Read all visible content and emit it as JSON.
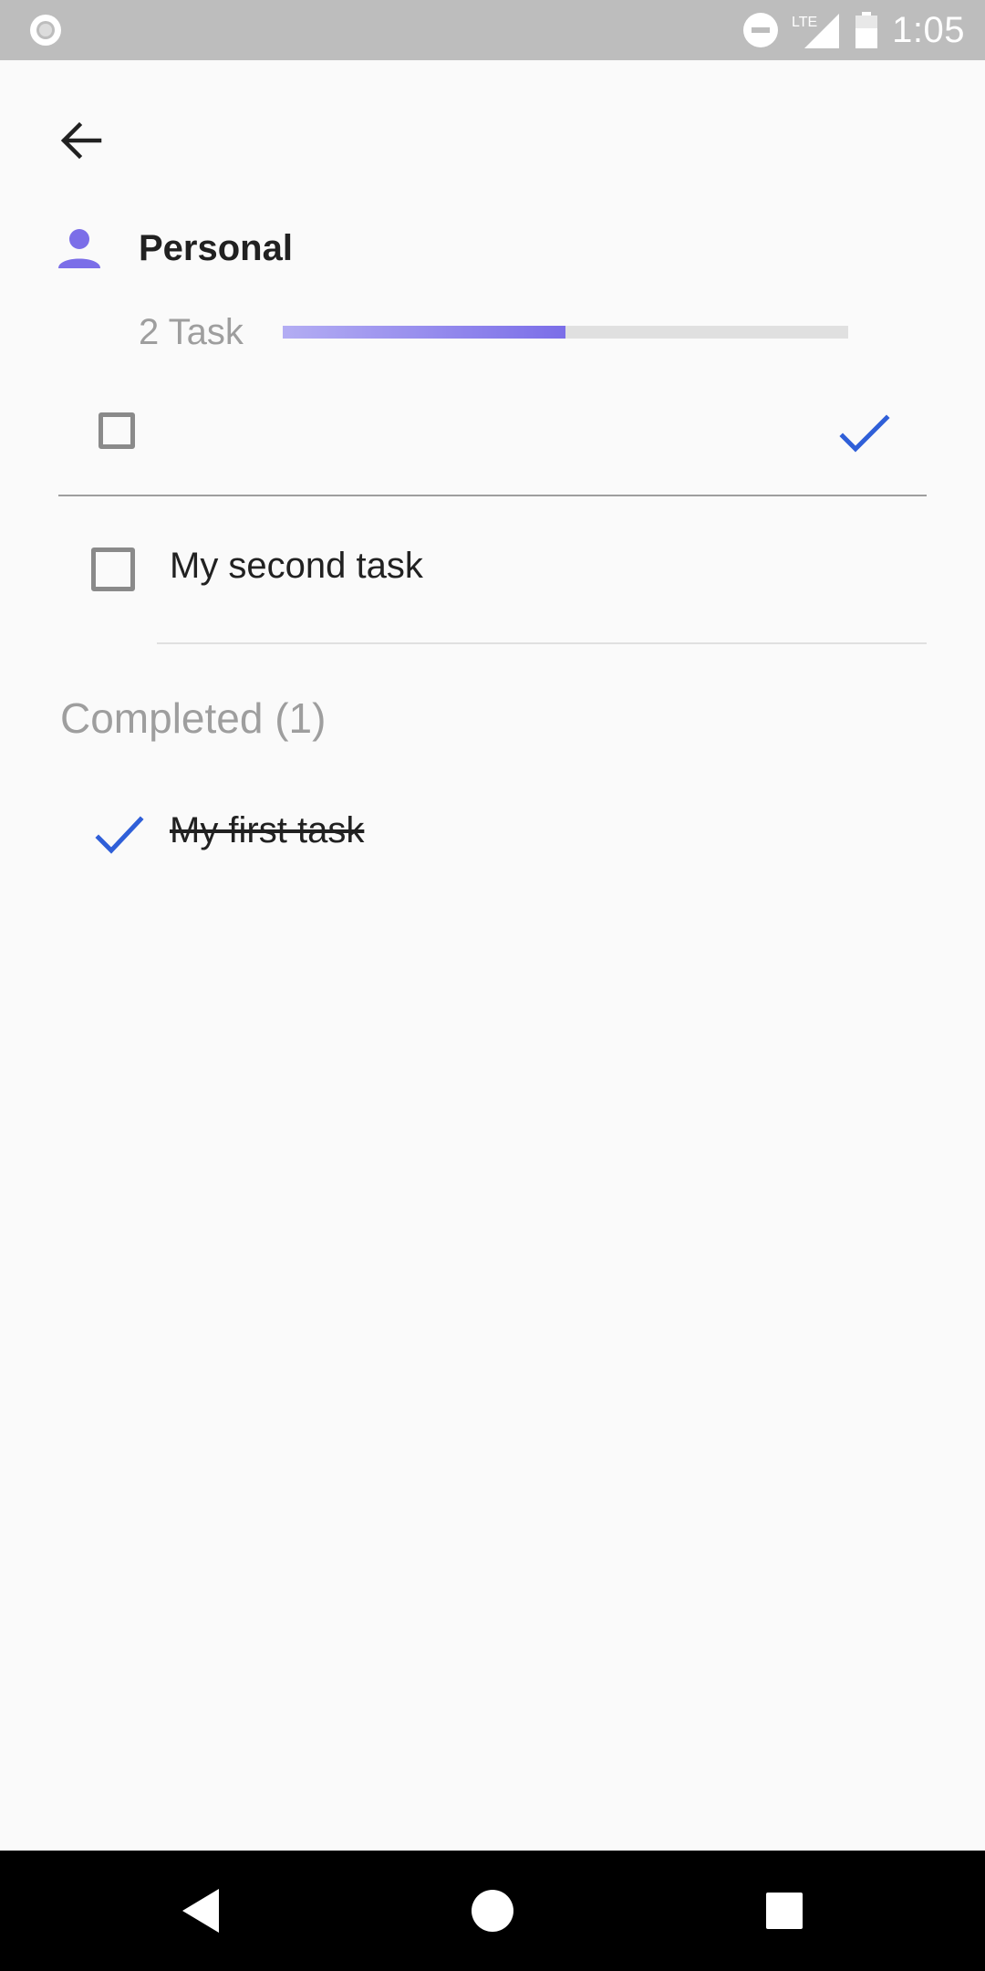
{
  "status_bar": {
    "time": "1:05",
    "network": "LTE",
    "icons": [
      "circle-notification-icon",
      "do-not-disturb-icon",
      "lte-signal-icon",
      "battery-icon"
    ]
  },
  "header": {
    "back_icon": "arrow-back-icon",
    "list_icon": "person-icon",
    "list_title": "Personal",
    "task_count": "2 Task",
    "progress": 0.5
  },
  "new_task": {
    "value": "",
    "placeholder": "",
    "confirm_icon": "check-icon"
  },
  "tasks": [
    {
      "label": "My second task",
      "completed": false
    }
  ],
  "completed_section": {
    "header": "Completed (1)",
    "items": [
      {
        "label": "My first task",
        "completed": true
      }
    ]
  },
  "nav_bar": {
    "icons": [
      "back-triangle-icon",
      "home-circle-icon",
      "recents-square-icon"
    ]
  },
  "colors": {
    "accent_purple": "#7b6ee8",
    "check_blue": "#2f5fd8",
    "status_bar_bg": "#bdbdbd"
  }
}
